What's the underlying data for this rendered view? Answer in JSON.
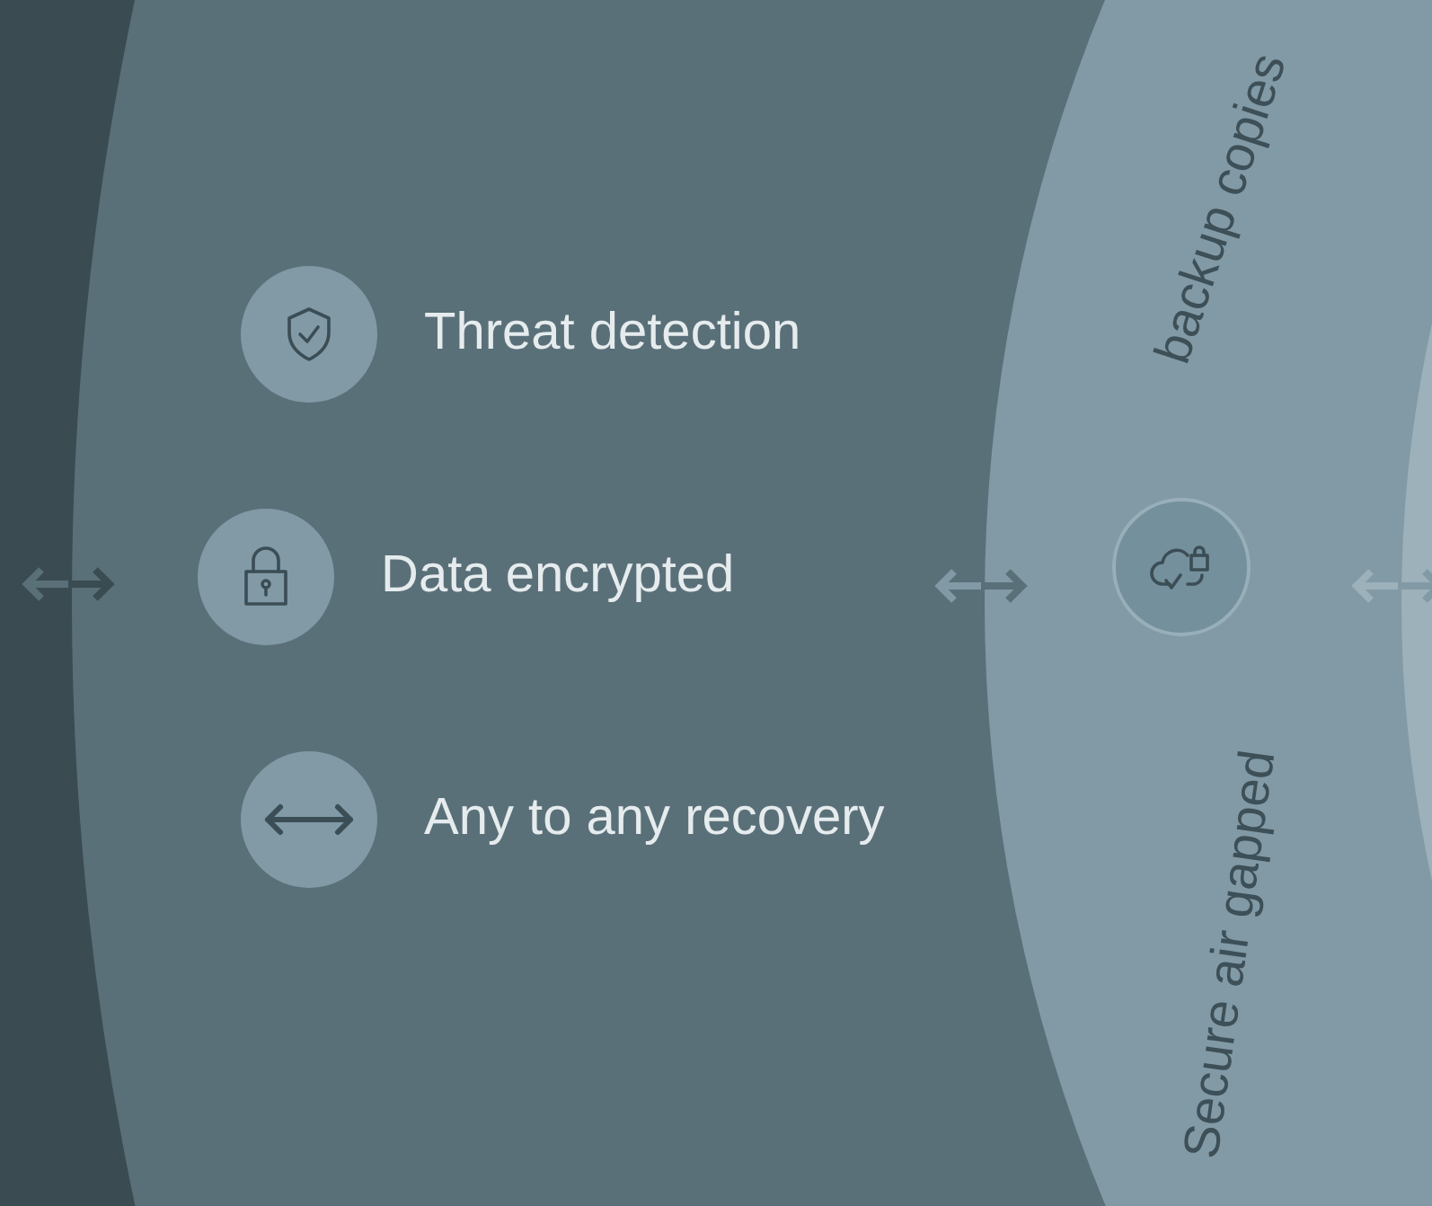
{
  "features": [
    {
      "kind": "shield",
      "label": "Threat detection"
    },
    {
      "kind": "lock",
      "label": "Data encrypted"
    },
    {
      "kind": "arrows",
      "label": "Any to any recovery"
    }
  ],
  "ring_labels": {
    "top": "backup copies",
    "bottom": "Secure air gapped"
  }
}
